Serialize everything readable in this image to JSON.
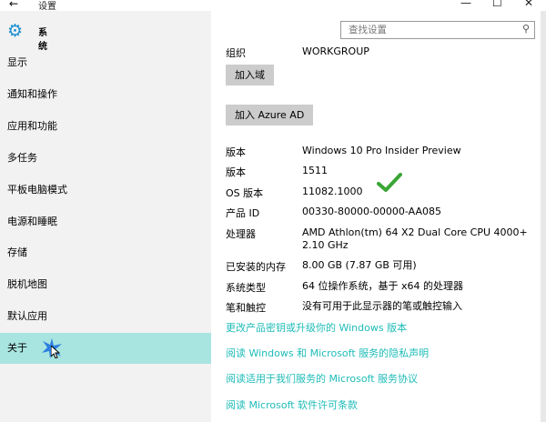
{
  "window": {
    "back": "←",
    "title": "设置",
    "minimize": "—",
    "maximize": "☐",
    "close": "✕"
  },
  "sidebar": {
    "brand_label": "系统",
    "items": [
      {
        "label": "显示"
      },
      {
        "label": "通知和操作"
      },
      {
        "label": "应用和功能"
      },
      {
        "label": "多任务"
      },
      {
        "label": "平板电脑模式"
      },
      {
        "label": "电源和睡眠"
      },
      {
        "label": "存储"
      },
      {
        "label": "脱机地图"
      },
      {
        "label": "默认应用"
      },
      {
        "label": "关于"
      }
    ],
    "selected_index": 9,
    "selected_color": "#a8e4e0"
  },
  "search": {
    "placeholder": "查找设置",
    "icon": "search-icon"
  },
  "about": {
    "org_label": "组织",
    "org_value": "WORKGROUP",
    "join_domain": "加入域",
    "join_azure": "加入 Azure AD",
    "rows": [
      {
        "k": "版本",
        "v": "Windows 10 Pro Insider Preview"
      },
      {
        "k": "版本",
        "v": "1511"
      },
      {
        "k": "OS 版本",
        "v": "11082.1000"
      },
      {
        "k": "产品 ID",
        "v": "00330-80000-00000-AA085"
      },
      {
        "k": "处理器",
        "v": "AMD Athlon(tm) 64 X2 Dual Core CPU 4000+ 2.10 GHz"
      },
      {
        "k": "已安装的内存",
        "v": "8.00 GB (7.87 GB 可用)"
      },
      {
        "k": "系统类型",
        "v": "64 位操作系统，基于 x64 的处理器"
      },
      {
        "k": "笔和触控",
        "v": "没有可用于此显示器的笔或触控输入"
      }
    ],
    "links": [
      "更改产品密钥或升级你的 Windows 版本",
      "阅读 Windows 和 Microsoft 服务的隐私声明",
      "阅读适用于我们服务的 Microsoft 服务协议",
      "阅读 Microsoft 软件许可条款"
    ],
    "link_color": "#1fbcb8"
  }
}
